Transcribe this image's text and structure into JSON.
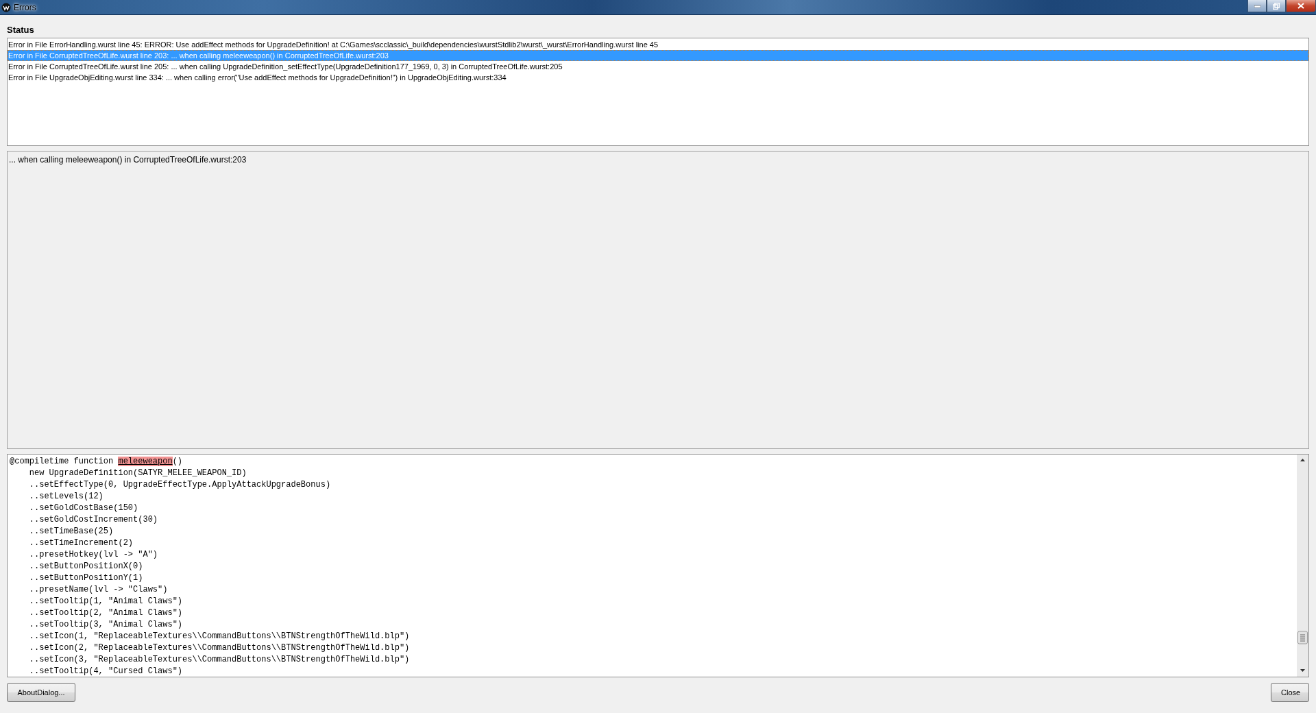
{
  "window": {
    "title": "Errors"
  },
  "status_label": "Status",
  "errors": [
    {
      "text": "Error in File ErrorHandling.wurst line 45: ERROR: Use addEffect methods for UpgradeDefinition!  at C:\\Games\\scclassic\\_build\\dependencies\\wurstStdlib2\\wurst\\_wurst\\ErrorHandling.wurst line 45",
      "selected": false
    },
    {
      "text": "Error in File CorruptedTreeOfLife.wurst line 203: ... when calling meleeweapon() in CorruptedTreeOfLife.wurst:203",
      "selected": true
    },
    {
      "text": "Error in File CorruptedTreeOfLife.wurst line 205: ... when calling UpgradeDefinition_setEffectType(UpgradeDefinition177_1969, 0, 3) in CorruptedTreeOfLife.wurst:205",
      "selected": false
    },
    {
      "text": "Error in File UpgradeObjEditing.wurst line 334: ... when calling error(\"Use addEffect methods for UpgradeDefinition!\") in UpgradeObjEditing.wurst:334",
      "selected": false
    }
  ],
  "detail": "... when calling meleeweapon() in CorruptedTreeOfLife.wurst:203",
  "code_lines": [
    {
      "parts": [
        {
          "text": "@compiletime function ",
          "kind": "plain"
        },
        {
          "text": "meleeweapon",
          "kind": "error"
        },
        {
          "text": "()",
          "kind": "plain"
        }
      ]
    },
    {
      "text": "    new UpgradeDefinition(SATYR_MELEE_WEAPON_ID)"
    },
    {
      "text": "    ..setEffectType(0, UpgradeEffectType.ApplyAttackUpgradeBonus)"
    },
    {
      "text": "    ..setLevels(12)"
    },
    {
      "text": "    ..setGoldCostBase(150)"
    },
    {
      "text": "    ..setGoldCostIncrement(30)"
    },
    {
      "text": "    ..setTimeBase(25)"
    },
    {
      "text": "    ..setTimeIncrement(2)"
    },
    {
      "text": "    ..presetHotkey(lvl -> \"A\")"
    },
    {
      "text": "    ..setButtonPositionX(0)"
    },
    {
      "text": "    ..setButtonPositionY(1)"
    },
    {
      "text": "    ..presetName(lvl -> \"Claws\")"
    },
    {
      "text": "    ..setTooltip(1, \"Animal Claws\")"
    },
    {
      "text": "    ..setTooltip(2, \"Animal Claws\")"
    },
    {
      "text": "    ..setTooltip(3, \"Animal Claws\")"
    },
    {
      "text": "    ..setIcon(1, \"ReplaceableTextures\\\\CommandButtons\\\\BTNStrengthOfTheWild.blp\")"
    },
    {
      "text": "    ..setIcon(2, \"ReplaceableTextures\\\\CommandButtons\\\\BTNStrengthOfTheWild.blp\")"
    },
    {
      "text": "    ..setIcon(3, \"ReplaceableTextures\\\\CommandButtons\\\\BTNStrengthOfTheWild.blp\")"
    },
    {
      "text": "    ..setTooltip(4, \"Cursed Claws\")"
    }
  ],
  "buttons": [
    {
      "label": "AboutDialog...",
      "kind": "left"
    },
    {
      "label": "Close",
      "kind": "right"
    }
  ]
}
